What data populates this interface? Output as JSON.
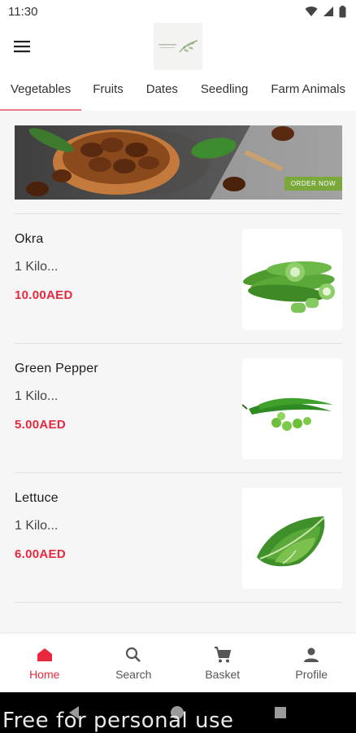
{
  "status_bar": {
    "time": "11:30"
  },
  "app_bar": {
    "menu_icon": "hamburger-menu-icon",
    "logo_icon": "brand-logo"
  },
  "tabs": [
    {
      "label": "Vegetables",
      "active": true
    },
    {
      "label": "Fruits",
      "active": false
    },
    {
      "label": "Dates",
      "active": false
    },
    {
      "label": "Seedling",
      "active": false
    },
    {
      "label": "Farm Animals",
      "active": false
    }
  ],
  "banner": {
    "cta": "ORDER NOW"
  },
  "products": [
    {
      "name": "Okra",
      "quantity": "1 Kilo...",
      "price": "10.00AED",
      "image_icon": "okra-image"
    },
    {
      "name": "Green Pepper",
      "quantity": "1 Kilo...",
      "price": "5.00AED",
      "image_icon": "green-pepper-image"
    },
    {
      "name": "Lettuce",
      "quantity": "1 Kilo...",
      "price": "6.00AED",
      "image_icon": "lettuce-image"
    }
  ],
  "bottom_nav": [
    {
      "label": "Home",
      "icon": "home-icon",
      "active": true
    },
    {
      "label": "Search",
      "icon": "search-icon",
      "active": false
    },
    {
      "label": "Basket",
      "icon": "cart-icon",
      "active": false
    },
    {
      "label": "Profile",
      "icon": "profile-icon",
      "active": false
    }
  ],
  "watermark": "Free for personal use",
  "colors": {
    "accent": "#e8283f",
    "tab_indicator": "#e87c88",
    "order_button": "#7aa83a"
  }
}
